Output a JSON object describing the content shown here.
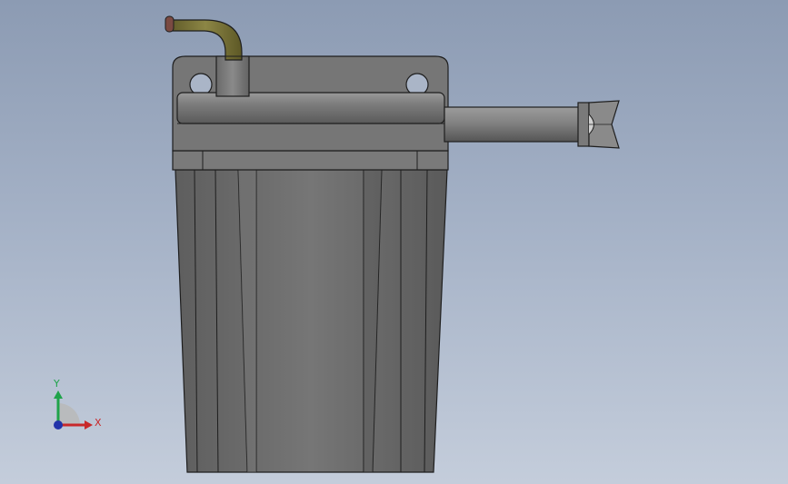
{
  "viewport": {
    "background_top": "#8c9bb3",
    "background_bottom": "#c4cddb"
  },
  "model": {
    "body_color": "#6e6e6e",
    "edge_color": "#1e1e1e",
    "tube_color": "#7f7a3c",
    "tube_tip_color": "#7a4a42"
  },
  "triad": {
    "y_label": "Y",
    "x_label": "X",
    "y_color": "#1fa34a",
    "x_color": "#c8282a",
    "z_color": "#2233aa"
  }
}
